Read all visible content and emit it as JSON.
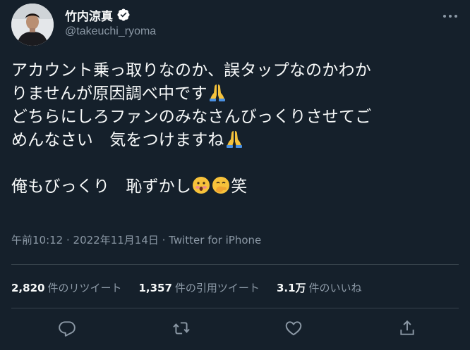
{
  "user": {
    "display_name": "竹内涼真",
    "handle": "@takeuchi_ryoma"
  },
  "tweet": {
    "line1": "アカウント乗っ取りなのか、誤タップなのかわか",
    "line2": "りませんが原因調べ中です",
    "line3": "どちらにしろファンのみなさんびっくりさせてご",
    "line4": "めんなさい　気をつけますね",
    "line5": "俺もびっくり　恥ずかし",
    "line5_tail": "笑"
  },
  "meta": {
    "text": "午前10:12 · 2022年11月14日 · Twitter for iPhone"
  },
  "stats": {
    "retweets_count": "2,820",
    "retweets_label": "件のリツイート",
    "quotes_count": "1,357",
    "quotes_label": "件の引用ツイート",
    "likes_count": "3.1万",
    "likes_label": "件のいいね"
  },
  "icons": {
    "verified": "verified-badge-icon",
    "more": "more-options-icon",
    "reply": "reply-icon",
    "retweet": "retweet-icon",
    "like": "heart-icon",
    "share": "share-icon"
  },
  "colors": {
    "background": "#15202b",
    "text": "#f7f9f9",
    "secondary_text": "#8b98a5",
    "divider": "#38444d"
  }
}
